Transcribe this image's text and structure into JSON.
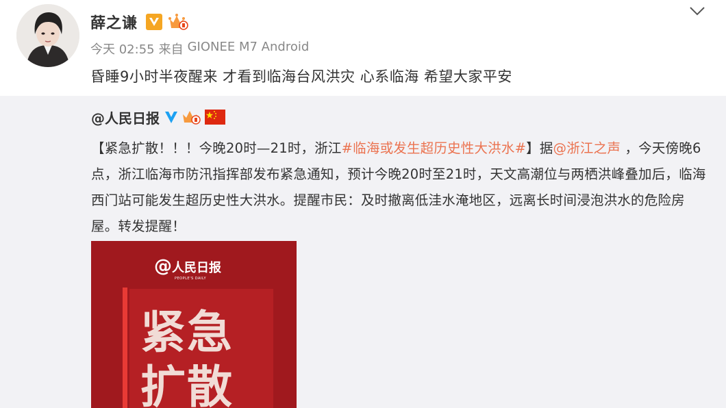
{
  "post": {
    "author": "薛之谦",
    "time": "今天 02:55",
    "source_prefix": "来自",
    "source": "GIONEE M7 Android",
    "text": "昏睡9小时半夜醒来 才看到临海台风洪灾 心系临海 希望大家平安"
  },
  "repost": {
    "author": "@人民日报",
    "segments": [
      {
        "text": "【紧急扩散！！！今晚20时—21时，浙江",
        "highlight": false
      },
      {
        "text": "#临海或发生超历史性大洪水#",
        "highlight": true
      },
      {
        "text": "】据",
        "highlight": false
      },
      {
        "text": "@浙江之声",
        "highlight": true
      },
      {
        "text": " ，今天傍晚6点，浙江临海市防汛指挥部发布紧急通知，预计今晚20时至21时，天文高潮位与两栖洪峰叠加后，临海西门站可能发生超历史性大洪水。提醒市民：及时撤离低洼水淹地区，远离长时间浸泡洪水的危险房屋。转发提醒！",
        "highlight": false
      }
    ],
    "image": {
      "logo_at": "@",
      "logo_name": "人民日报",
      "logo_sub": "PEOPLE'S DAILY",
      "line1": "紧急",
      "line2": "扩散"
    }
  },
  "colors": {
    "highlight": "#eb7350",
    "verified_blue": "#1da1f2",
    "verified_orange": "#f5a623",
    "card_red": "#a0191e"
  },
  "icons": {
    "more": "chevron-down-icon",
    "verified_personal": "orange-v-icon",
    "verified_org": "blue-v-icon",
    "member": "crown-icon",
    "flag": "china-flag-icon"
  }
}
